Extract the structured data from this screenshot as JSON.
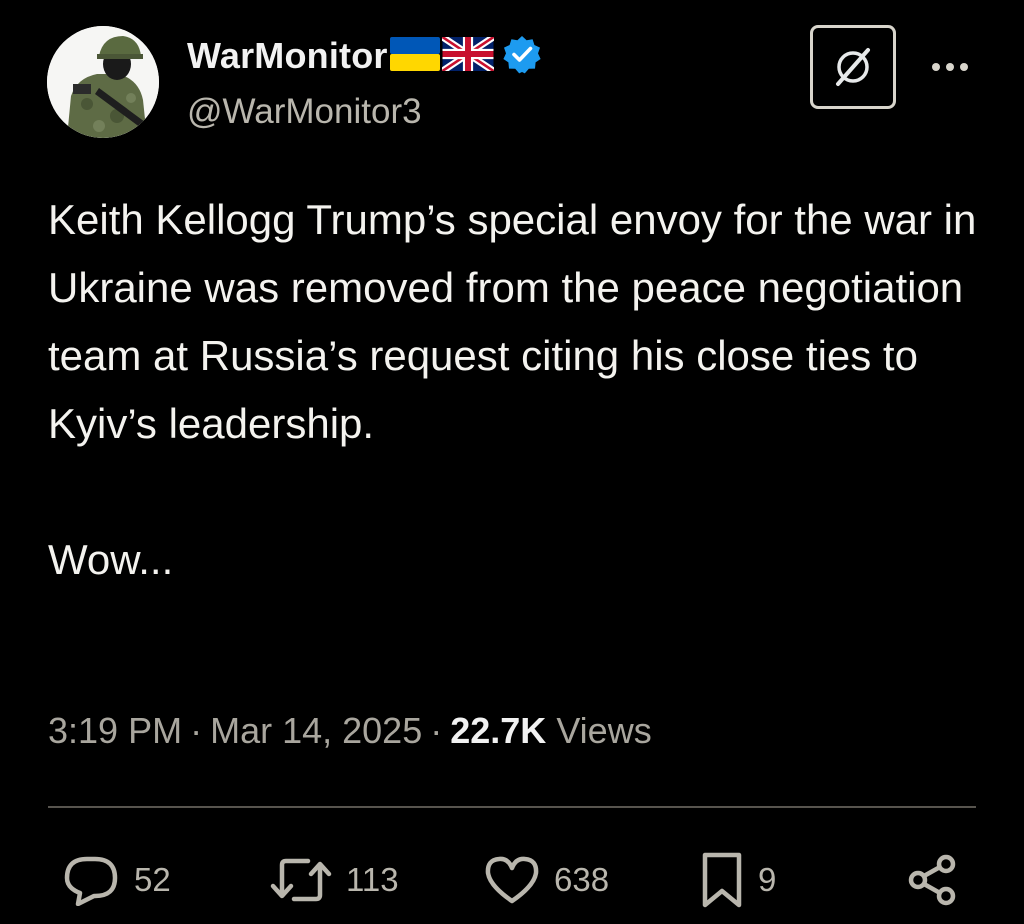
{
  "author": {
    "display_name": "WarMonitor",
    "flags": [
      "ukraine-flag-icon",
      "uk-flag-icon"
    ],
    "verified_icon": "verified-badge-icon",
    "handle": "@WarMonitor3"
  },
  "header_actions": {
    "grok_icon": "grok-slash-icon",
    "more_icon": "more-dots-icon"
  },
  "post": {
    "text_paragraphs": [
      "Keith Kellogg Trump’s special envoy for the war in Ukraine was removed from the peace negotiation team at Russia’s request citing his close ties to Kyiv’s leadership.",
      "Wow..."
    ]
  },
  "meta": {
    "time": "3:19 PM",
    "separator": "·",
    "date": "Mar 14, 2025",
    "views_count": "22.7K",
    "views_label": "Views"
  },
  "actions": {
    "replies": "52",
    "reposts": "113",
    "likes": "638",
    "bookmarks": "9"
  },
  "colors": {
    "background": "#000000",
    "text_primary": "#f4f3ef",
    "text_secondary": "#a9a69e",
    "verified": "#1d9bf0",
    "ukraine_blue": "#0057b7",
    "ukraine_yellow": "#ffd700"
  }
}
